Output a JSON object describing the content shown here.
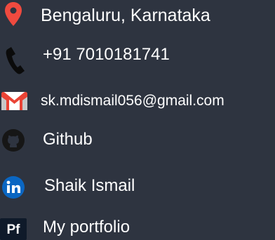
{
  "contacts": [
    {
      "label": "Bengaluru, Karnataka",
      "icon": "location-pin-icon"
    },
    {
      "label": "+91 7010181741",
      "icon": "phone-icon"
    },
    {
      "label": "sk.mdismail056@gmail.com",
      "icon": "gmail-icon"
    },
    {
      "label": "Github",
      "icon": "github-icon"
    },
    {
      "label": "Shaik Ismail",
      "icon": "linkedin-icon"
    },
    {
      "label": "My portfolio",
      "icon": "portfolio-icon"
    }
  ],
  "colors": {
    "background": "#2e3440",
    "text": "#ffffff",
    "location_pin": "#ef4a3f",
    "gmail_red": "#ea4335",
    "linkedin_blue": "#0a66c2",
    "github_dark": "#161616",
    "portfolio_dark": "#0f1a2a"
  }
}
